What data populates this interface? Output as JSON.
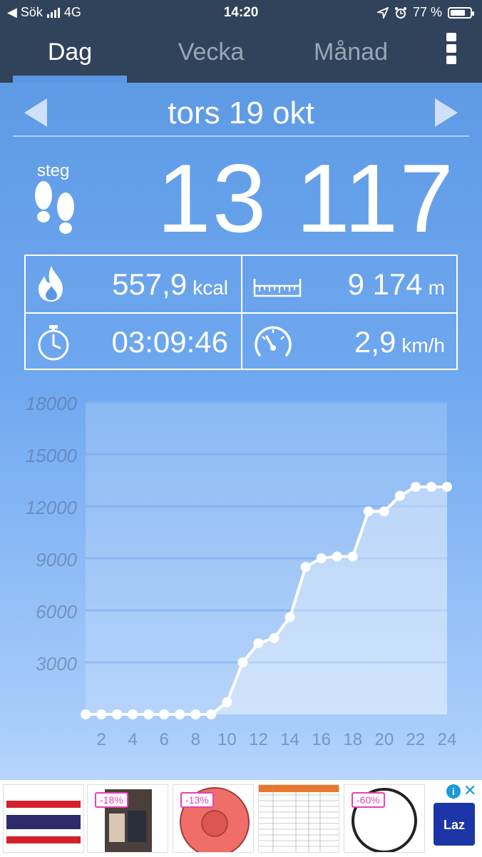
{
  "status_bar": {
    "back_label": "◀ Sök",
    "network": "4G",
    "time": "14:20",
    "battery_percent": "77 %",
    "battery_level": 0.77
  },
  "tabs": [
    {
      "label": "Dag",
      "active": true
    },
    {
      "label": "Vecka",
      "active": false
    },
    {
      "label": "Månad",
      "active": false
    }
  ],
  "date": "tors 19 okt",
  "steps": {
    "label": "steg",
    "value": "13 117"
  },
  "stats": {
    "calories": {
      "value": "557,9",
      "unit": "kcal"
    },
    "distance": {
      "value": "9 174",
      "unit": "m"
    },
    "duration": {
      "value": "03:09:46"
    },
    "speed": {
      "value": "2,9",
      "unit": "km/h"
    }
  },
  "chart_data": {
    "type": "line",
    "x": [
      1,
      2,
      3,
      4,
      5,
      6,
      7,
      8,
      9,
      10,
      11,
      12,
      13,
      14,
      15,
      16,
      17,
      18,
      19,
      20,
      21,
      22,
      23,
      24
    ],
    "series": [
      {
        "values": [
          0,
          0,
          0,
          0,
          0,
          0,
          0,
          0,
          0,
          700,
          3000,
          4100,
          4400,
          5600,
          8500,
          9000,
          9100,
          9100,
          11700,
          11700,
          12600,
          13117,
          13117,
          13117
        ]
      }
    ],
    "x_ticks": [
      2,
      4,
      6,
      8,
      10,
      12,
      14,
      16,
      18,
      20,
      22,
      24
    ],
    "y_ticks": [
      3000,
      6000,
      9000,
      12000,
      15000,
      18000
    ],
    "ylim": [
      0,
      18000
    ],
    "xlim": [
      1,
      24
    ],
    "grid": true
  },
  "ads": [
    {
      "badge": ""
    },
    {
      "badge": "-18%"
    },
    {
      "badge": "-13%"
    },
    {
      "badge": ""
    },
    {
      "badge": "-60%"
    }
  ],
  "ad_brand": "Laz",
  "colors": {
    "header_bg": "#31435a",
    "accent_blue": "#5a96e2",
    "ad_badge": "#e83fb7"
  }
}
